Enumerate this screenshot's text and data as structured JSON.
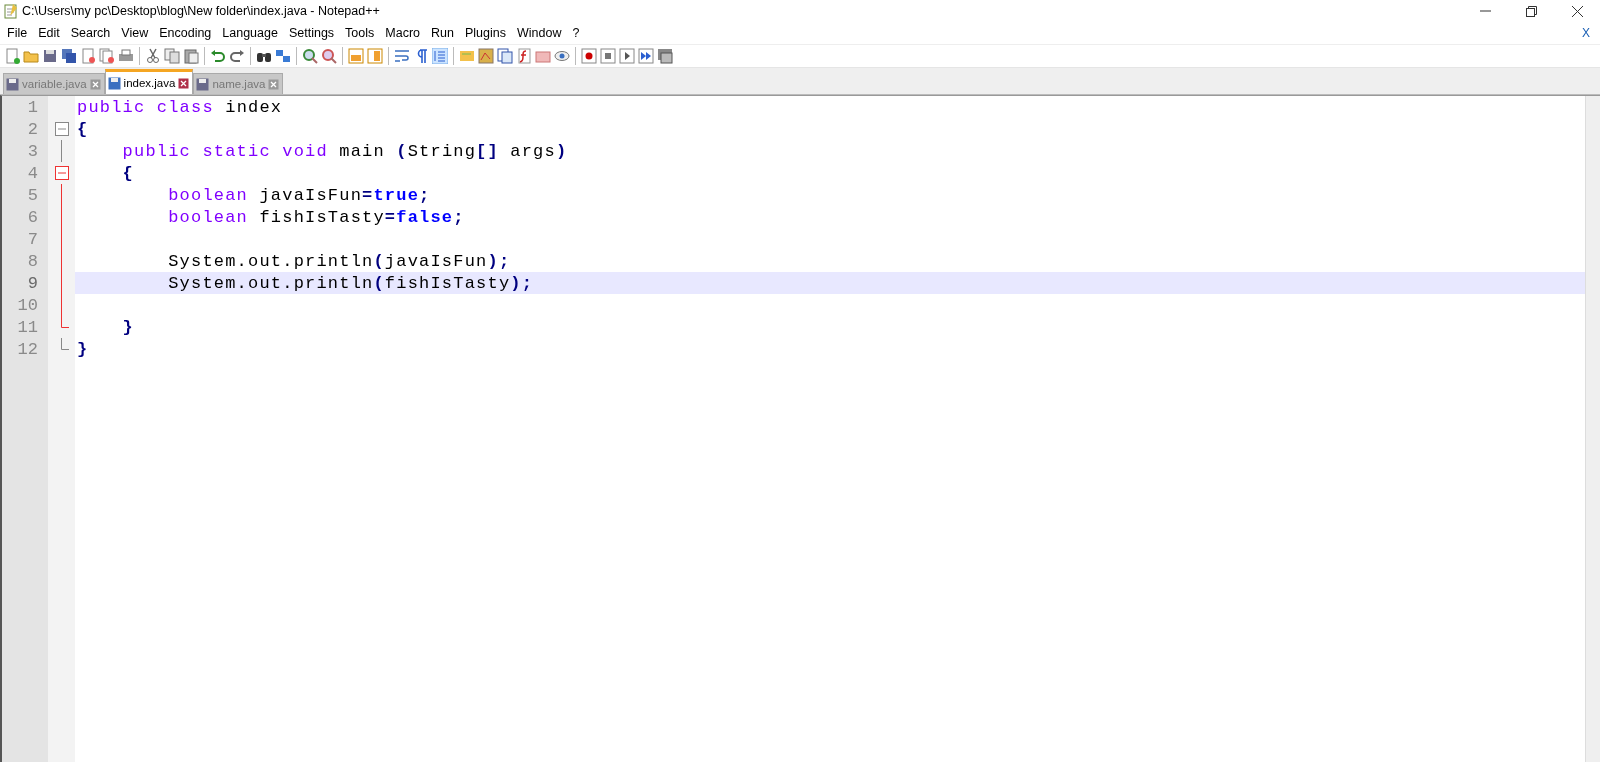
{
  "window": {
    "title": "C:\\Users\\my pc\\Desktop\\blog\\New folder\\index.java - Notepad++"
  },
  "menu": {
    "items": [
      "File",
      "Edit",
      "Search",
      "View",
      "Encoding",
      "Language",
      "Settings",
      "Tools",
      "Macro",
      "Run",
      "Plugins",
      "Window",
      "?"
    ],
    "close_glyph": "X"
  },
  "tabs": [
    {
      "label": "variable.java",
      "selected": false
    },
    {
      "label": "index.java",
      "selected": true
    },
    {
      "label": "name.java",
      "selected": false
    }
  ],
  "editor": {
    "lines": [
      {
        "number": "1",
        "selected": false,
        "tokens": [
          {
            "text": "public class ",
            "kind": "keyword"
          },
          {
            "text": "index",
            "kind": "plain"
          }
        ]
      },
      {
        "number": "2",
        "selected": false,
        "fold_marker": {
          "kind": "head",
          "current": false
        },
        "tokens": [
          {
            "text": "{",
            "kind": "punct"
          }
        ]
      },
      {
        "number": "3",
        "selected": false,
        "fold_marker": {
          "kind": "body",
          "current": false
        },
        "tokens": [
          {
            "text": "    public static void ",
            "kind": "keyword"
          },
          {
            "text": "main ",
            "kind": "plain"
          },
          {
            "text": "(",
            "kind": "punct"
          },
          {
            "text": "String",
            "kind": "plain"
          },
          {
            "text": "[]",
            "kind": "punct"
          },
          {
            "text": " args",
            "kind": "plain"
          },
          {
            "text": ")",
            "kind": "punct"
          }
        ]
      },
      {
        "number": "4",
        "selected": false,
        "fold_marker": {
          "kind": "head",
          "current": true
        },
        "tokens": [
          {
            "text": "    {",
            "kind": "punct"
          }
        ]
      },
      {
        "number": "5",
        "selected": false,
        "fold_marker": {
          "kind": "body",
          "current": true
        },
        "tokens": [
          {
            "text": "        boolean ",
            "kind": "keyword"
          },
          {
            "text": "javaIsFun",
            "kind": "plain"
          },
          {
            "text": "=",
            "kind": "punct"
          },
          {
            "text": "true",
            "kind": "value"
          },
          {
            "text": ";",
            "kind": "punct"
          }
        ]
      },
      {
        "number": "6",
        "selected": false,
        "fold_marker": {
          "kind": "body",
          "current": true
        },
        "tokens": [
          {
            "text": "        boolean ",
            "kind": "keyword"
          },
          {
            "text": "fishIsTasty",
            "kind": "plain"
          },
          {
            "text": "=",
            "kind": "punct"
          },
          {
            "text": "false",
            "kind": "value"
          },
          {
            "text": ";",
            "kind": "punct"
          }
        ]
      },
      {
        "number": "7",
        "selected": false,
        "fold_marker": {
          "kind": "body",
          "current": true
        }
      },
      {
        "number": "8",
        "selected": false,
        "fold_marker": {
          "kind": "body",
          "current": true
        },
        "tokens": [
          {
            "text": "        System.out.println",
            "kind": "plain"
          },
          {
            "text": "(",
            "kind": "punct"
          },
          {
            "text": "javaIsFun",
            "kind": "plain"
          },
          {
            "text": ");",
            "kind": "punct"
          }
        ]
      },
      {
        "number": "9",
        "selected": true,
        "fold_marker": {
          "kind": "body",
          "current": true
        },
        "tokens": [
          {
            "text": "        System.out.println",
            "kind": "plain"
          },
          {
            "text": "(",
            "kind": "punct"
          },
          {
            "text": "fishIsTasty",
            "kind": "plain"
          },
          {
            "text": ");",
            "kind": "punct"
          }
        ]
      },
      {
        "number": "10",
        "selected": false,
        "fold_marker": {
          "kind": "body",
          "current": true
        }
      },
      {
        "number": "11",
        "selected": false,
        "fold_marker": {
          "kind": "tail",
          "current": true
        },
        "tokens": [
          {
            "text": "    }",
            "kind": "punct"
          }
        ]
      },
      {
        "number": "12",
        "selected": false,
        "fold_marker": {
          "kind": "tail",
          "current": false
        },
        "tokens": [
          {
            "text": "}",
            "kind": "punct"
          }
        ]
      }
    ]
  }
}
